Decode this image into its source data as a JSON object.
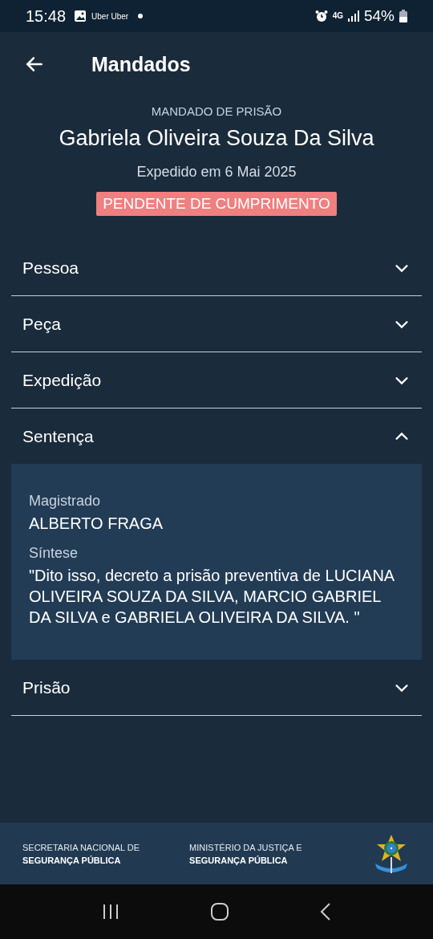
{
  "status_bar": {
    "time": "15:48",
    "notification": "Uber Uber",
    "network": "4G",
    "battery": "54%"
  },
  "header": {
    "title": "Mandados"
  },
  "warrant": {
    "type": "MANDADO DE PRISÃO",
    "name": "Gabriela Oliveira Souza Da Silva",
    "issued": "Expedido em 6 Mai 2025",
    "status": "PENDENTE DE CUMPRIMENTO"
  },
  "sections": [
    {
      "title": "Pessoa",
      "expanded": false
    },
    {
      "title": "Peça",
      "expanded": false
    },
    {
      "title": "Expedição",
      "expanded": false
    },
    {
      "title": "Sentença",
      "expanded": true,
      "fields": [
        {
          "label": "Magistrado",
          "value": "ALBERTO FRAGA"
        },
        {
          "label": "Síntese",
          "value": "\"Dito isso, decreto a prisão preventiva de LUCIANA OLIVEIRA SOUZA DA SILVA, MARCIO GABRIEL DA SILVA e GABRIELA OLIVEIRA DA SILVA. \""
        }
      ]
    },
    {
      "title": "Prisão",
      "expanded": false
    }
  ],
  "footer": [
    {
      "line_1": "SECRETARIA NACIONAL DE",
      "line_2": "SEGURANÇA PÚBLICA"
    },
    {
      "line_1": "MINISTÉRIO DA JUSTIÇA E",
      "line_2": "SEGURANÇA PÚBLICA"
    }
  ]
}
